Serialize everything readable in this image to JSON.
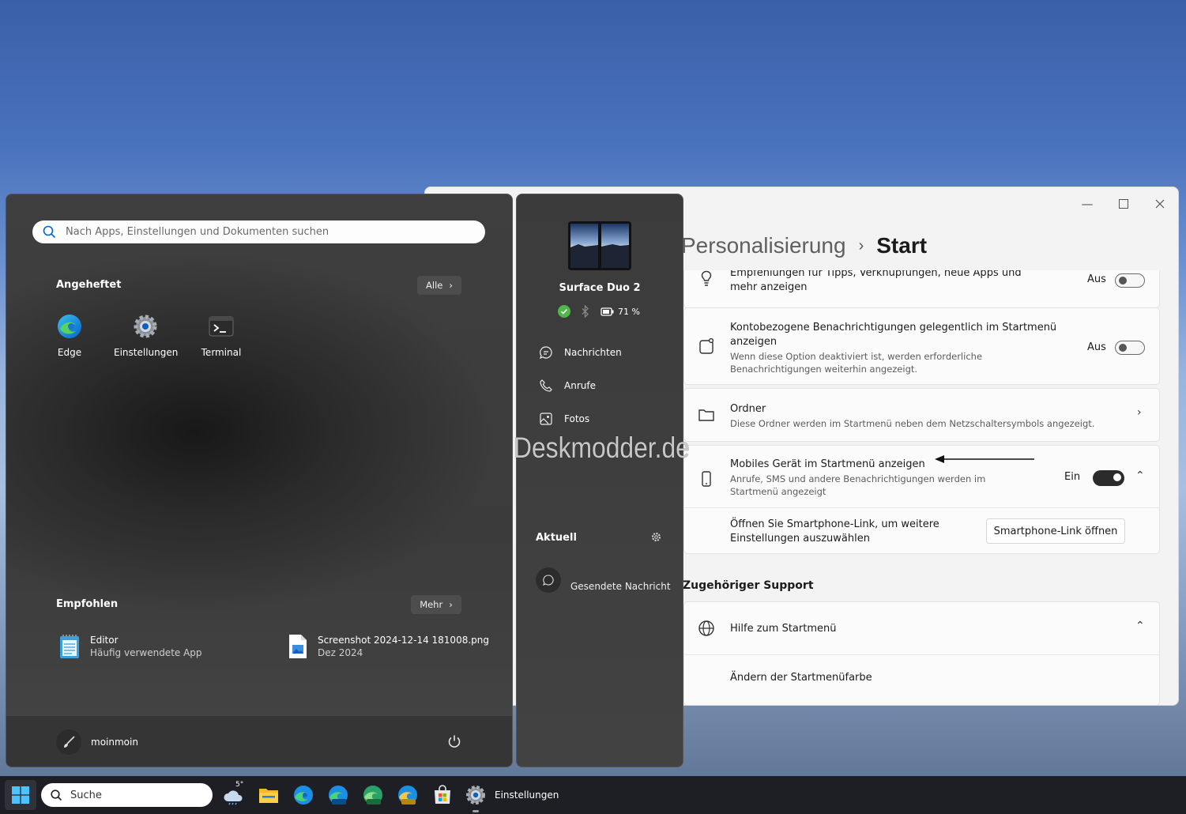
{
  "settings": {
    "breadcrumb_parent": "Personalisierung",
    "breadcrumb_current": "Start",
    "row_tips_title": "Empfehlungen für Tipps, Verknüpfungen, neue Apps und mehr anzeigen",
    "row_tips_state": "Aus",
    "row_account_title": "Kontobezogene Benachrichtigungen gelegentlich im Startmenü anzeigen",
    "row_account_desc": "Wenn diese Option deaktiviert ist, werden erforderliche Benachrichtigungen weiterhin angezeigt.",
    "row_account_state": "Aus",
    "row_folder_title": "Ordner",
    "row_folder_desc": "Diese Ordner werden im Startmenü neben dem Netzschaltersymbols angezeigt.",
    "row_mobile_title": "Mobiles Gerät im Startmenü anzeigen",
    "row_mobile_desc": "Anrufe, SMS und andere Benachrichtigungen werden im Startmenü angezeigt",
    "row_mobile_state": "Ein",
    "row_phonelink_text": "Öffnen Sie Smartphone-Link, um weitere Einstellungen auszuwählen",
    "row_phonelink_button": "Smartphone-Link öffnen",
    "support_title": "Zugehöriger Support",
    "support_help": "Hilfe zum Startmenü",
    "support_color": "Ändern der Startmenüfarbe"
  },
  "start_menu": {
    "search_placeholder": "Nach Apps, Einstellungen und Dokumenten suchen",
    "pinned_header": "Angeheftet",
    "all_button": "Alle",
    "pinned_apps": [
      "Edge",
      "Einstellungen",
      "Terminal"
    ],
    "recommended_header": "Empfohlen",
    "more_button": "Mehr",
    "recommended": [
      {
        "title": "Editor",
        "desc": "Häufig verwendete App"
      },
      {
        "title": "Screenshot 2024-12-14 181008.png",
        "desc": "Dez 2024"
      }
    ],
    "user_name": "moinmoin"
  },
  "phone_panel": {
    "device_name": "Surface Duo 2",
    "battery": "71 %",
    "nav": [
      "Nachrichten",
      "Anrufe",
      "Fotos"
    ],
    "current_header": "Aktuell",
    "current_item": "Gesendete Nachricht",
    "watermark": "Deskmodder.de"
  },
  "taskbar": {
    "search_label": "Suche",
    "weather_temp": "5°",
    "active_app_label": "Einstellungen"
  },
  "colors": {
    "accent_blue": "#0067c0",
    "toggle_on": "#2b2b2b"
  }
}
